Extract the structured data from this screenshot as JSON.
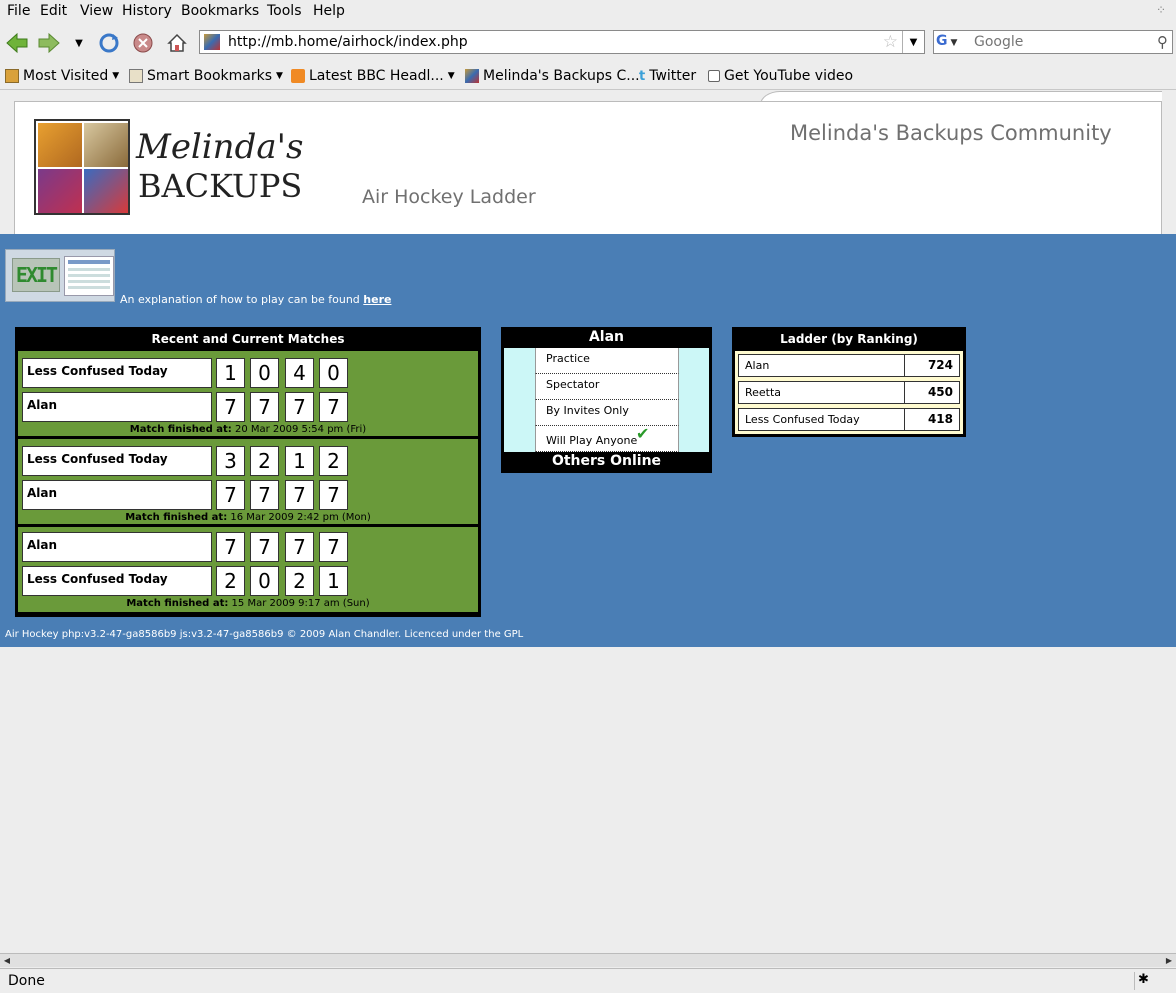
{
  "browser": {
    "menu": [
      "File",
      "Edit",
      "View",
      "History",
      "Bookmarks",
      "Tools",
      "Help"
    ],
    "url": "http://mb.home/airhock/index.php",
    "search_placeholder": "Google",
    "search_engine": "G",
    "bookmarks": [
      {
        "label": "Most Visited",
        "icon": "folder-special-icon",
        "dropdown": true
      },
      {
        "label": "Smart Bookmarks",
        "icon": "folder-icon",
        "dropdown": true
      },
      {
        "label": "Latest BBC Headl...",
        "icon": "rss-icon",
        "dropdown": true
      },
      {
        "label": "Melinda's Backups C...",
        "icon": "site-favicon",
        "dropdown": false
      },
      {
        "label": "Twitter",
        "icon": "twitter-icon",
        "dropdown": false
      },
      {
        "label": "Get YouTube video",
        "icon": "bookmarklet-icon",
        "dropdown": false
      }
    ],
    "status": "Done"
  },
  "header": {
    "logo_line1": "Melinda's",
    "logo_line2": "BACKUPS",
    "community_title": "Melinda's Backups Community",
    "page_title": "Air Hockey Ladder"
  },
  "exit": {
    "sign_text": "EXIT"
  },
  "explanation": {
    "text": "An explanation of how to play can be found ",
    "link": "here"
  },
  "matches": {
    "title": "Recent and Current Matches",
    "time_label": "Match finished at:",
    "items": [
      {
        "players": [
          {
            "name": "Less Confused Today",
            "scores": [
              "1",
              "0",
              "4",
              "0"
            ]
          },
          {
            "name": "Alan",
            "scores": [
              "7",
              "7",
              "7",
              "7"
            ]
          }
        ],
        "time": "20 Mar 2009 5:54 pm (Fri)"
      },
      {
        "players": [
          {
            "name": "Less Confused Today",
            "scores": [
              "3",
              "2",
              "1",
              "2"
            ]
          },
          {
            "name": "Alan",
            "scores": [
              "7",
              "7",
              "7",
              "7"
            ]
          }
        ],
        "time": "16 Mar 2009 2:42 pm (Mon)"
      },
      {
        "players": [
          {
            "name": "Alan",
            "scores": [
              "7",
              "7",
              "7",
              "7"
            ]
          },
          {
            "name": "Less Confused Today",
            "scores": [
              "2",
              "0",
              "2",
              "1"
            ]
          }
        ],
        "time": "15 Mar 2009 9:17 am (Sun)"
      }
    ]
  },
  "user_panel": {
    "name": "Alan",
    "options": [
      "Practice",
      "Spectator",
      "By Invites Only",
      "Will Play Anyone"
    ],
    "selected_option": "Will Play Anyone",
    "others_label": "Others Online"
  },
  "ladder": {
    "title": "Ladder (by Ranking)",
    "rows": [
      {
        "name": "Alan",
        "score": "724"
      },
      {
        "name": "Reetta",
        "score": "450"
      },
      {
        "name": "Less Confused Today",
        "score": "418"
      }
    ]
  },
  "footer": "Air Hockey php:v3.2-47-ga8586b9 js:v3.2-47-ga8586b9 © 2009 Alan Chandler. Licenced under the GPL",
  "colors": {
    "page_bg": "#4a7eb5",
    "match_bg": "#6a9a3a",
    "user_menu_bg": "#ccf7f7",
    "ladder_bg": "#fffbd0"
  }
}
